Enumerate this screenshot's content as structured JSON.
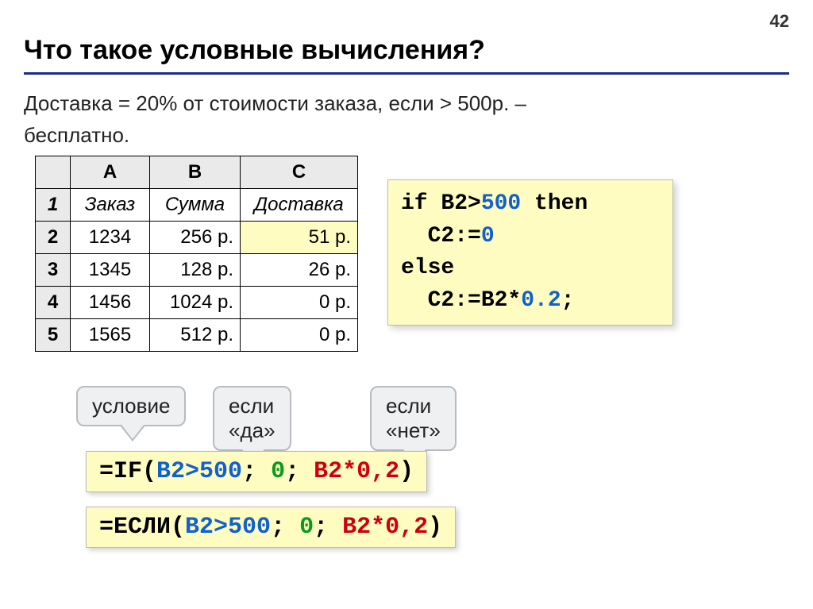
{
  "page_number": "42",
  "title": "Что такое условные вычисления?",
  "description_l1": "Доставка = 20% от стоимости заказа, если > 500р. –",
  "description_l2": "бесплатно.",
  "sheet": {
    "col_a": "A",
    "col_b": "B",
    "col_c": "C",
    "rownums": [
      "1",
      "2",
      "3",
      "4",
      "5"
    ],
    "headers": {
      "a": "Заказ",
      "b": "Сумма",
      "c": "Доставка"
    },
    "rows": [
      {
        "a": "1234",
        "b": "256 р.",
        "c": "51 р."
      },
      {
        "a": "1345",
        "b": "128 р.",
        "c": "26 р."
      },
      {
        "a": "1456",
        "b": "1024 р.",
        "c": "0 р."
      },
      {
        "a": "1565",
        "b": "512 р.",
        "c": "0 р."
      }
    ]
  },
  "pseudocode": {
    "l1_a": "if",
    "l1_b": " B2>",
    "l1_c": "500",
    "l1_d": " then",
    "l2_a": "  C2:=",
    "l2_b": "0",
    "l3": "else",
    "l4_a": "  C2:=B2*",
    "l4_b": "0.2",
    "l4_c": ";"
  },
  "callouts": {
    "cond": "условие",
    "yes": "если «да»",
    "no": "если «нет»"
  },
  "formula1": {
    "pre": "=",
    "fn": "IF(",
    "cond": "B2>500",
    "sep1": "; ",
    "yes": "0",
    "sep2": "; ",
    "no": "B2*0,2",
    "post": ")"
  },
  "formula2": {
    "pre": "=",
    "fn": "ЕСЛИ(",
    "cond": "B2>500",
    "sep1": "; ",
    "yes": "0",
    "sep2": "; ",
    "no": "B2*0,2",
    "post": ")"
  }
}
